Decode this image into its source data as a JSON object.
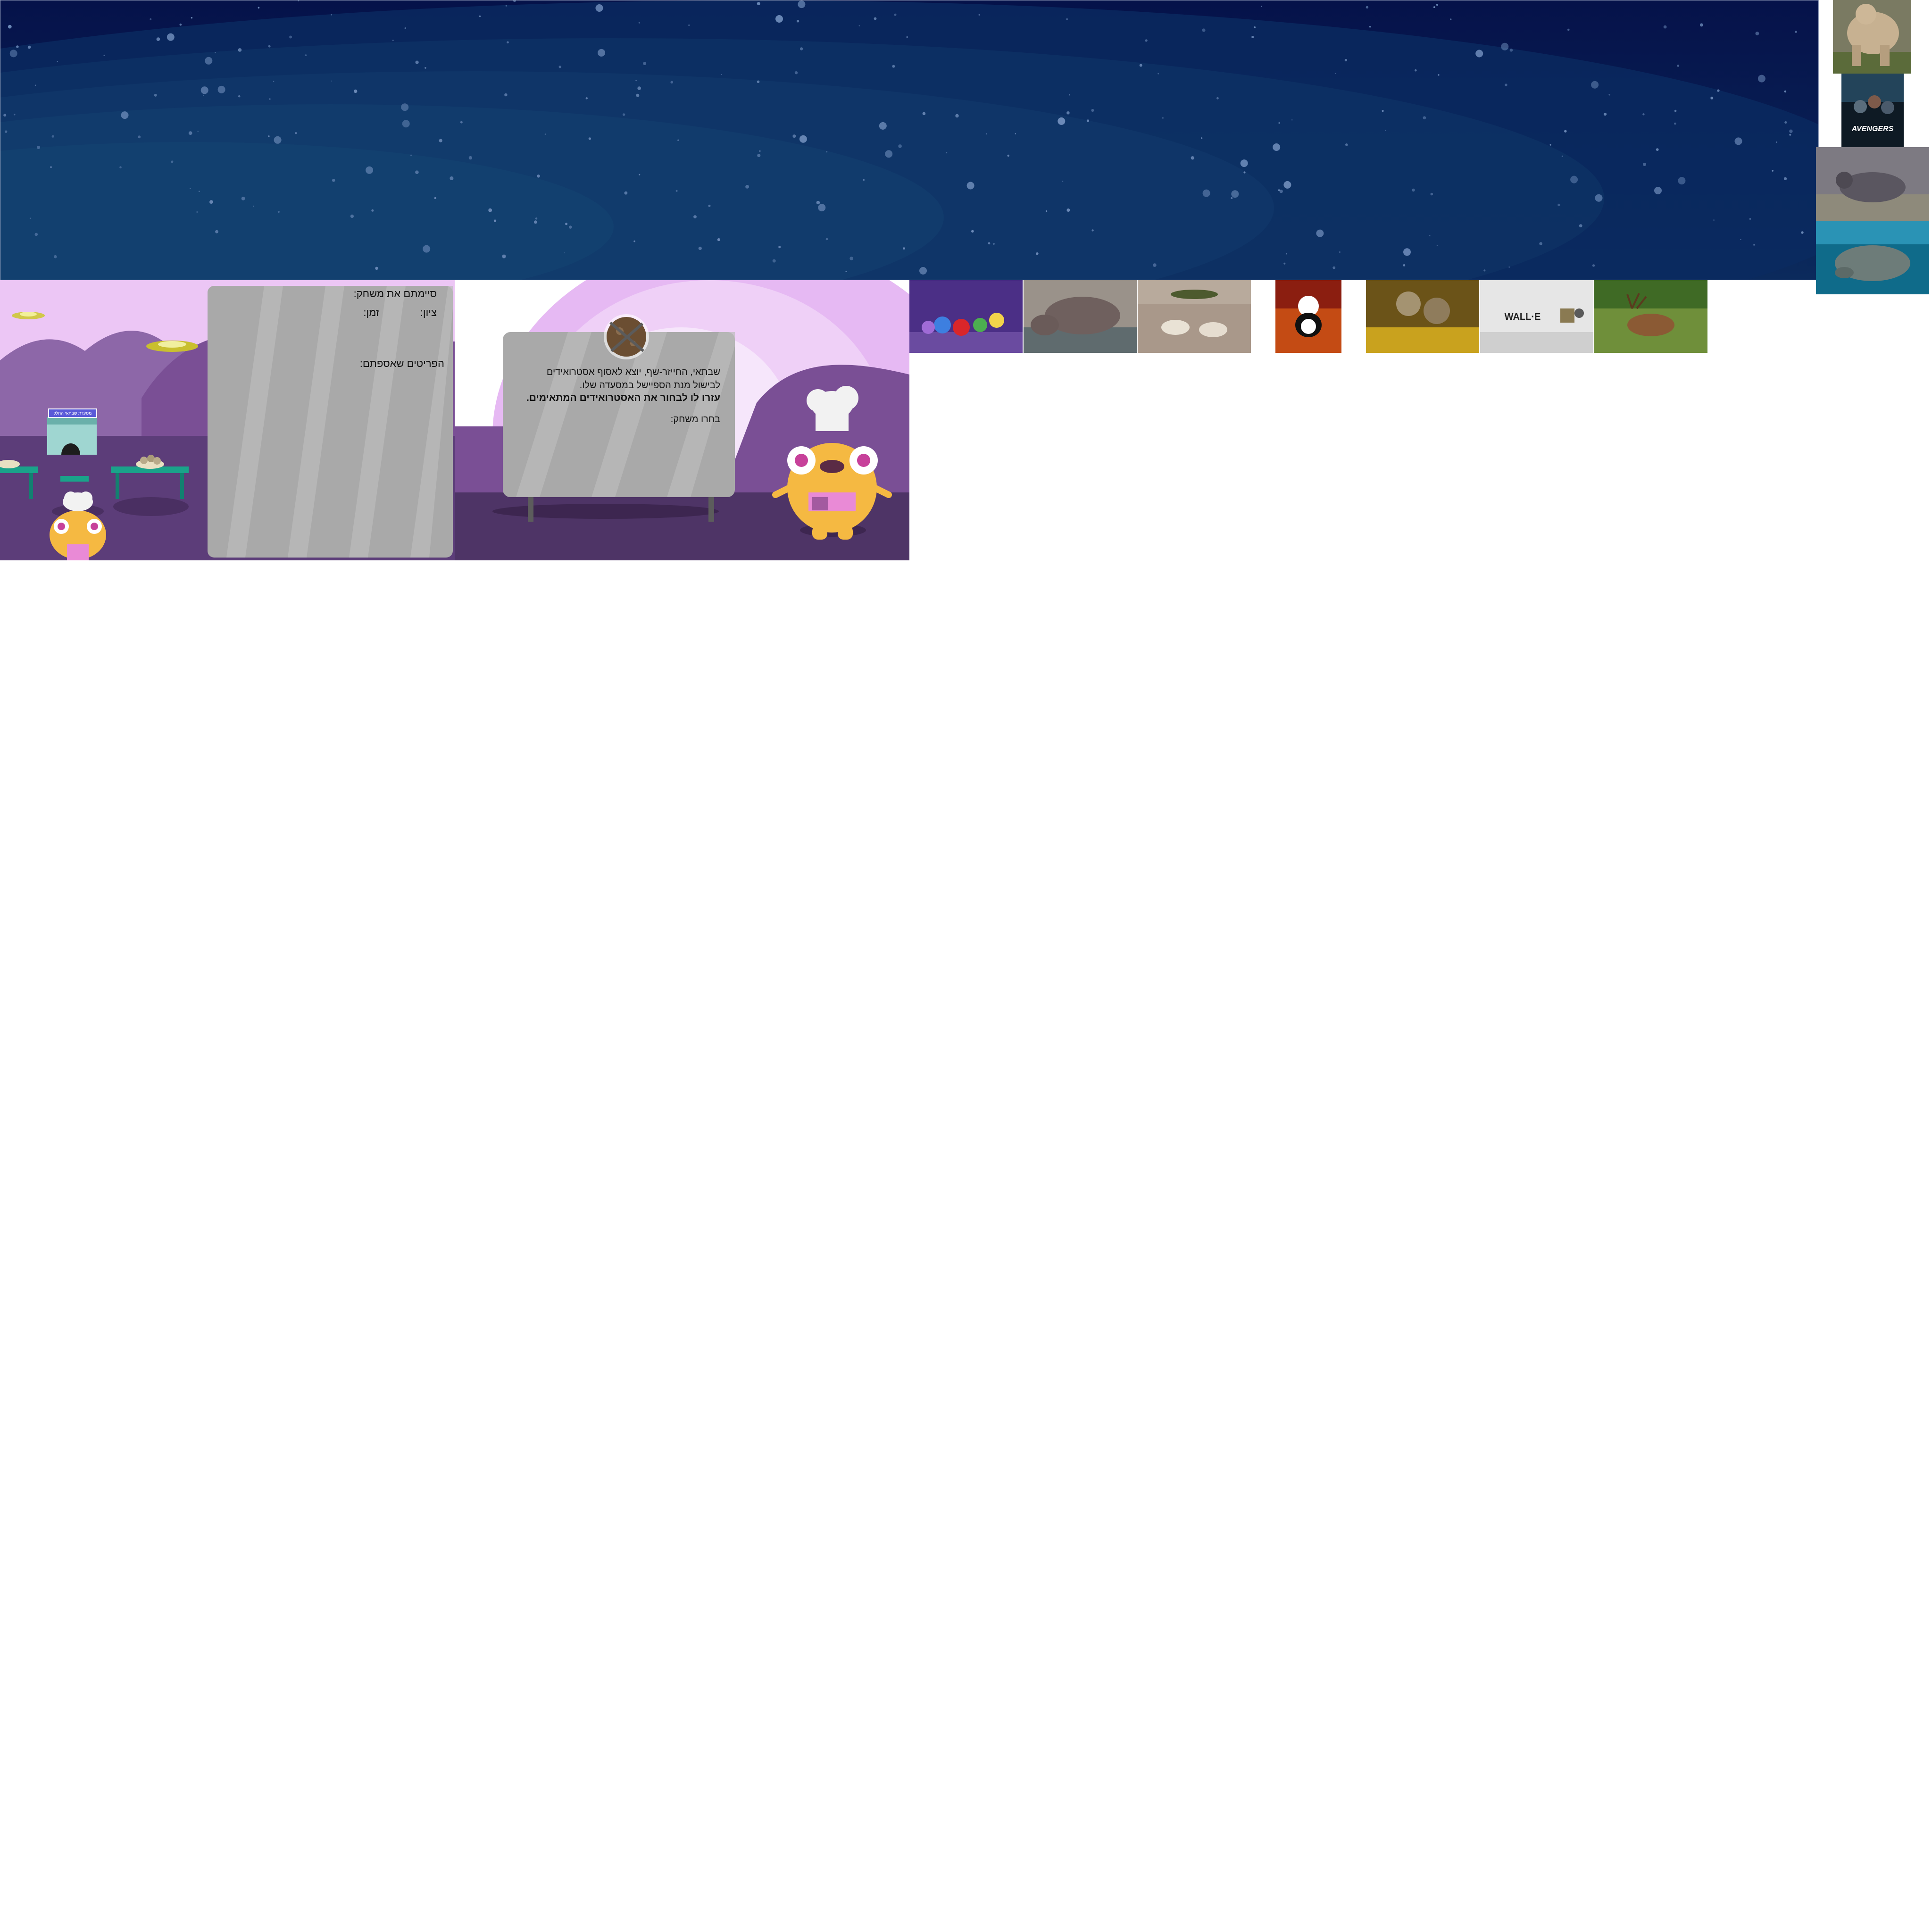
{
  "end_screen": {
    "finished_label": "סיימתם את משחק:",
    "score_label": "ציון:",
    "time_label": "זמן:",
    "items_label": "הפריטים שאספתם:",
    "shop_sign": "מסעדת שבתאי החלל"
  },
  "intro_screen": {
    "line1": "שבתאי, החייזר-שף, יוצא לאסוף אסטרואידים",
    "line2": "לבישול מנת הספיישל במסעדה שלו.",
    "line3": "עזרו לו לבחור את האסטרואידים המתאימים.",
    "choose_label": "בחרו משחק:"
  },
  "thumbnails": {
    "wall_e_label": "WALL·E",
    "avengers_label": "AVENGERS"
  },
  "colors": {
    "space_dark": "#06124a",
    "space_mid": "#123f6e",
    "purple_light": "#ecc0f5",
    "purple_hill": "#7a4f95",
    "purple_ground": "#4e3466",
    "board_gray": "#a9a9a9",
    "monster_yellow": "#f5b942",
    "apron_pink": "#e98ad6",
    "table_teal": "#1aa38a"
  }
}
